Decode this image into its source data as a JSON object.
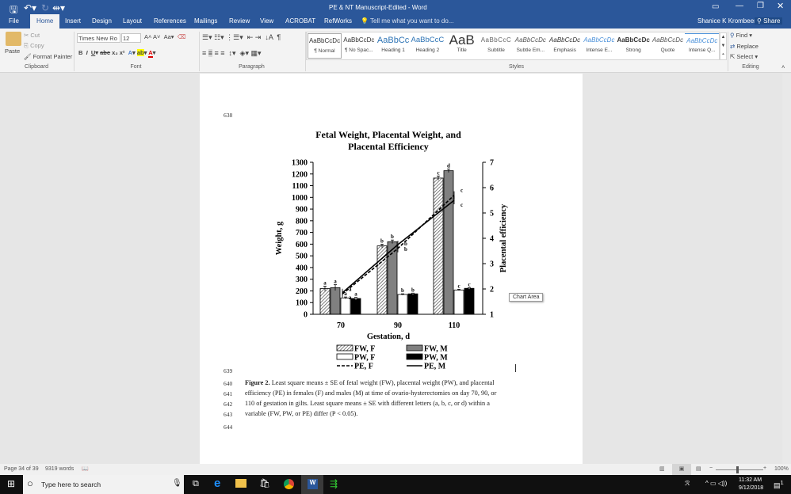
{
  "window": {
    "title": "PE & NT Manuscript-Edited - Word",
    "user": "Shanice K Krombeen",
    "share": "Share"
  },
  "tabs": [
    "File",
    "Home",
    "Insert",
    "Design",
    "Layout",
    "References",
    "Mailings",
    "Review",
    "View",
    "ACROBAT",
    "RefWorks"
  ],
  "tell_me": "Tell me what you want to do...",
  "clipboard": {
    "paste": "Paste",
    "cut": "Cut",
    "copy": "Copy",
    "format_painter": "Format Painter",
    "label": "Clipboard"
  },
  "font": {
    "name": "Times New Ro",
    "size": "12",
    "label": "Font"
  },
  "paragraph": {
    "label": "Paragraph"
  },
  "styles": {
    "label": "Styles",
    "items": [
      {
        "preview": "AaBbCcDc",
        "name": "¶ Normal"
      },
      {
        "preview": "AaBbCcDc",
        "name": "¶ No Spac..."
      },
      {
        "preview": "AaBbCc",
        "name": "Heading 1"
      },
      {
        "preview": "AaBbCcC",
        "name": "Heading 2"
      },
      {
        "preview": "AaB",
        "name": "Title"
      },
      {
        "preview": "AaBbCcC",
        "name": "Subtitle"
      },
      {
        "preview": "AaBbCcDc",
        "name": "Subtle Em..."
      },
      {
        "preview": "AaBbCcDc",
        "name": "Emphasis"
      },
      {
        "preview": "AaBbCcDc",
        "name": "Intense E..."
      },
      {
        "preview": "AaBbCcDc",
        "name": "Strong"
      },
      {
        "preview": "AaBbCcDc",
        "name": "Quote"
      },
      {
        "preview": "AaBbCcDc",
        "name": "Intense Q..."
      }
    ]
  },
  "editing": {
    "find": "Find",
    "replace": "Replace",
    "select": "Select",
    "label": "Editing"
  },
  "document": {
    "line_numbers": [
      "638",
      "639",
      "640",
      "641",
      "642",
      "643",
      "644"
    ],
    "caption_bold": "Figure 2.",
    "caption_lines": [
      " Least square means ± SE of fetal weight (FW), placental weight (PW), and placental",
      "efficiency (PE) in females (F) and males (M) at time of ovario-hysterectomies on day 70, 90, or",
      "110 of gestation in gilts. Least square means ± SE with different letters (a, b, c, or d) within a",
      "variable (FW, PW, or PE) differ (P < 0.05)."
    ],
    "tooltip": "Chart Area"
  },
  "chart_data": {
    "type": "bar",
    "title": [
      "Fetal Weight, Placental Weight, and",
      "Placental Efficiency"
    ],
    "xlabel": "Gestation, d",
    "ylabel": "Weight, g",
    "y2label": "Placental efficiency",
    "categories": [
      "70",
      "90",
      "110"
    ],
    "ylim": [
      0,
      1300
    ],
    "yticks": [
      "0",
      "100",
      "200",
      "300",
      "400",
      "500",
      "600",
      "700",
      "800",
      "900",
      "1000",
      "1100",
      "1200",
      "1300"
    ],
    "y2lim": [
      1,
      7
    ],
    "y2ticks": [
      "1",
      "2",
      "3",
      "4",
      "5",
      "6",
      "7"
    ],
    "series": [
      {
        "name": "FW, F",
        "type": "bar",
        "values": [
          220,
          585,
          1165
        ],
        "se": [
          20,
          15,
          18
        ],
        "letters": [
          "a",
          "b",
          "c"
        ]
      },
      {
        "name": "FW, M",
        "type": "bar",
        "values": [
          228,
          620,
          1228
        ],
        "se": [
          25,
          15,
          15
        ],
        "letters": [
          "a",
          "b",
          "d"
        ]
      },
      {
        "name": "PW, F",
        "type": "bar",
        "values": [
          140,
          170,
          208
        ],
        "se": [
          8,
          5,
          5
        ],
        "letters": [
          "a",
          "b",
          "c"
        ]
      },
      {
        "name": "PW, M",
        "type": "bar",
        "values": [
          135,
          175,
          222
        ],
        "se": [
          10,
          6,
          6
        ],
        "letters": [
          "a",
          "b",
          "c"
        ]
      },
      {
        "name": "PE, F",
        "type": "line",
        "axis": "right",
        "values": [
          1.8,
          3.6,
          5.7
        ],
        "letters": [
          "a",
          "b",
          "c"
        ]
      },
      {
        "name": "PE, M",
        "type": "line",
        "axis": "right",
        "values": [
          1.85,
          3.75,
          5.5
        ],
        "letters": [
          "a",
          "b",
          "c"
        ]
      }
    ],
    "legend": "bottom"
  },
  "status": {
    "page": "Page 34 of 39",
    "words": "9319 words",
    "zoom": "100%"
  },
  "taskbar": {
    "search": "Type here to search",
    "time": "11:32 AM",
    "date": "9/12/2018",
    "notifications": "1"
  }
}
